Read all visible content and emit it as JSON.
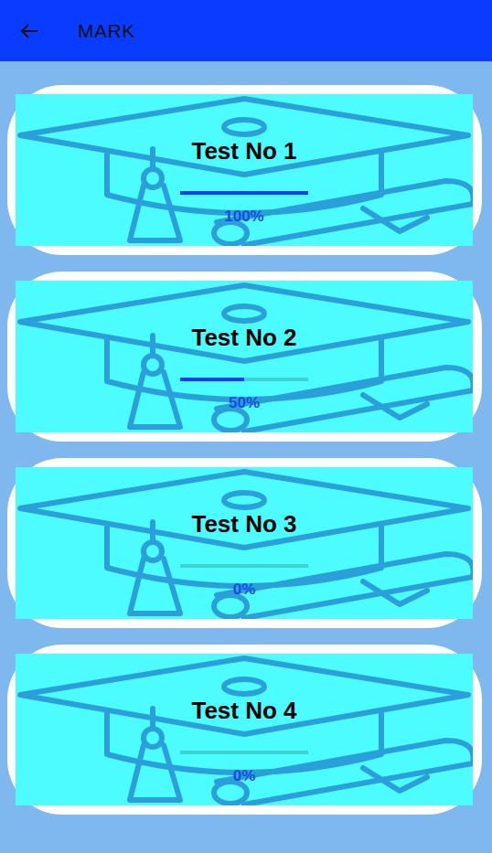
{
  "appbar": {
    "title": "MARK"
  },
  "tests": [
    {
      "name": "Test No 1",
      "level": 1.0,
      "percent": "100%"
    },
    {
      "name": "Test No 2",
      "level": 0.5,
      "percent": "50%"
    },
    {
      "name": "Test No 3",
      "level": 0,
      "percent": "0%"
    },
    {
      "name": "Test No 4",
      "level": 0,
      "percent": "0%"
    }
  ]
}
